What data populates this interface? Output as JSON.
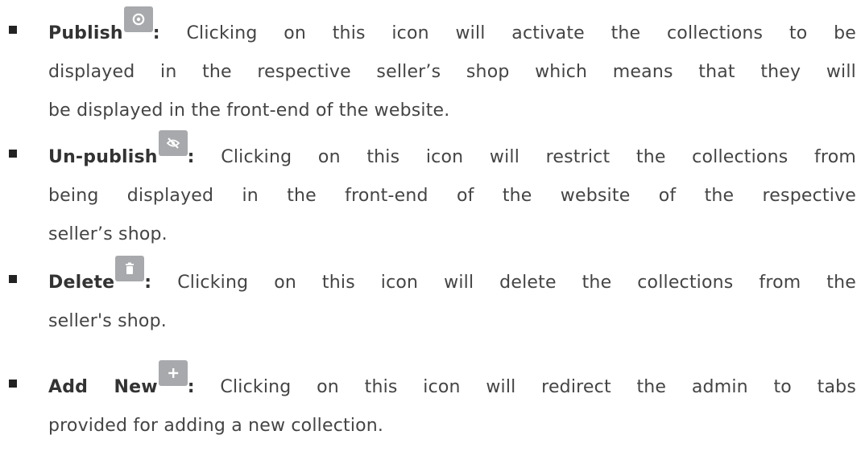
{
  "items": [
    {
      "term": "Publish",
      "icon": "eye-icon",
      "colon": ":",
      "lines": [
        "Clicking on this icon will activate the collections to be",
        "displayed in the respective seller’s shop which means that they will",
        "be displayed in the front-end of the website."
      ]
    },
    {
      "term": "Un-publish",
      "icon": "eye-slash-icon",
      "colon": ":",
      "lines": [
        "Clicking on this icon will restrict the collections from",
        "being displayed in the front-end of the website of the respective",
        "seller’s shop."
      ]
    },
    {
      "term": "Delete",
      "icon": "trash-icon",
      "colon": ":",
      "lines": [
        "Clicking on this icon will delete the collections from the",
        "seller's shop."
      ]
    },
    {
      "term": "Add New",
      "icon": "plus-icon",
      "colon": ":",
      "lines": [
        "Clicking on this icon will redirect the admin to tabs",
        "provided for adding a new collection."
      ]
    }
  ],
  "colors": {
    "text": "#444444",
    "icon_button_bg": "#a7a9ac",
    "icon_glyph": "#ffffff",
    "bullet": "#222222"
  }
}
